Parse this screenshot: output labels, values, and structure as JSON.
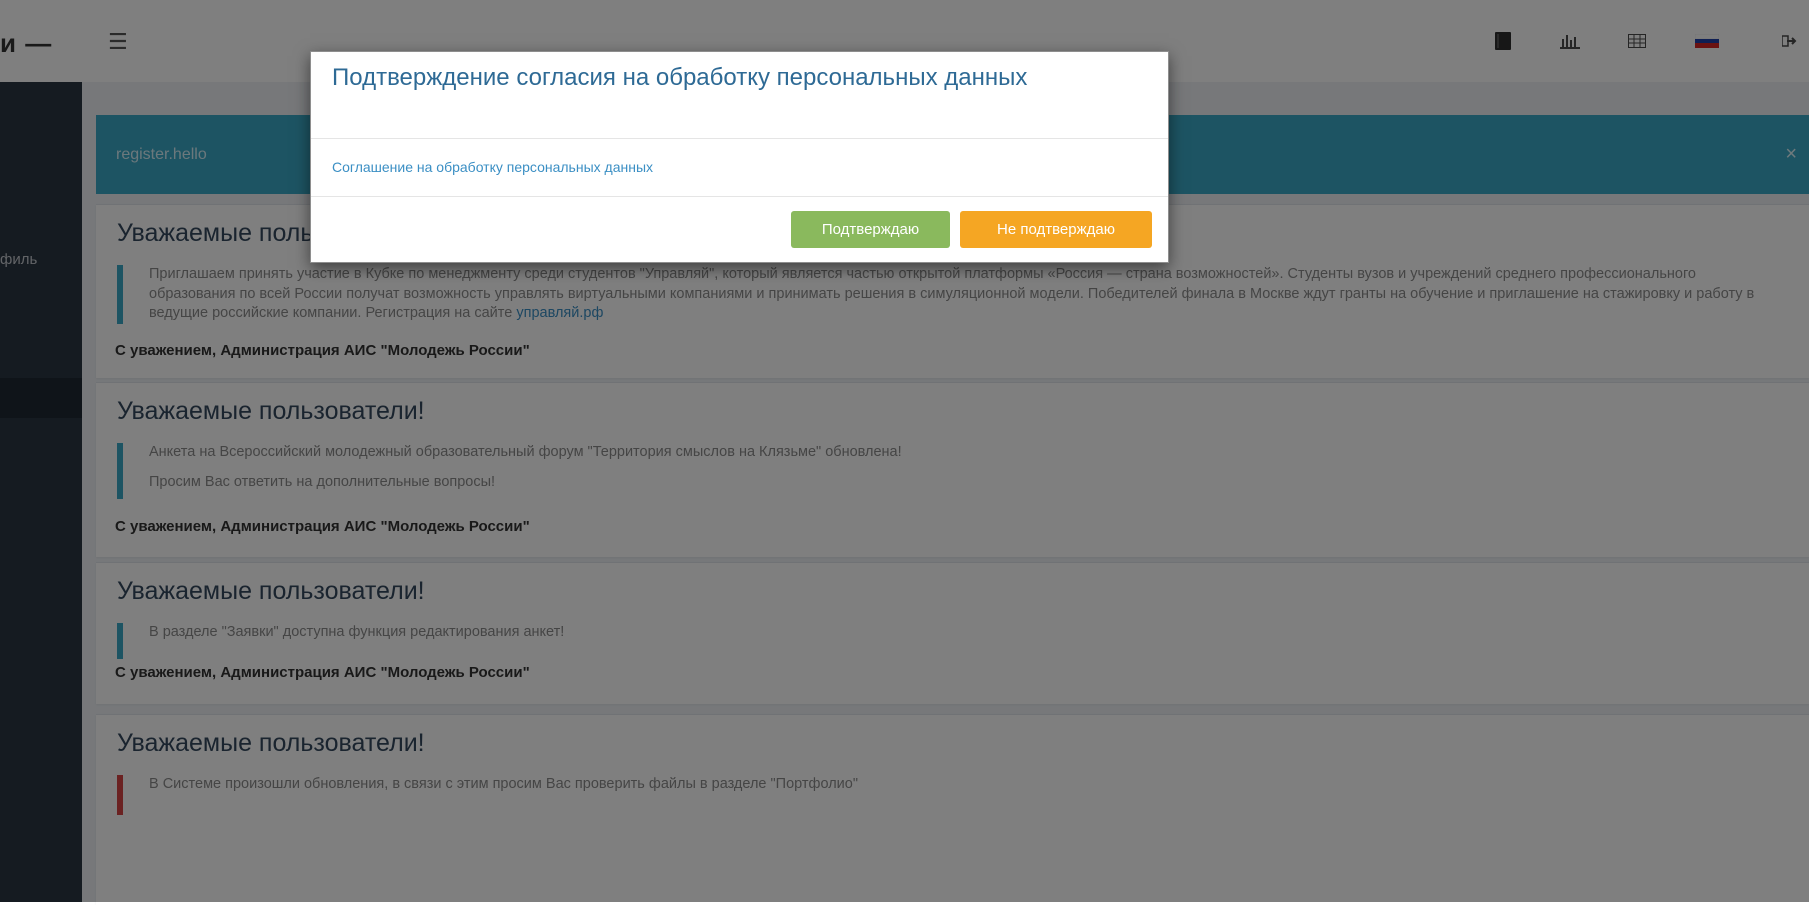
{
  "header": {
    "brand": "и —",
    "icons": {
      "book": "book-icon",
      "chart": "bar-chart-icon",
      "grid": "grid-icon",
      "flag": "russia-flag-icon",
      "logout": "logout-icon"
    }
  },
  "sidebar": {
    "items": [
      {
        "label": "филь"
      },
      {
        "label": ""
      }
    ]
  },
  "alert": {
    "text": "register.hello",
    "close": "×"
  },
  "news": [
    {
      "title": "Уважаемые пользователи!",
      "body": [
        "Приглашаем принять участие в Кубке по менеджменту среди студентов \"Управляй\", который является частью открытой платформы «Россия — страна возможностей». Студенты вузов и учреждений среднего профессионального образования по всей России получат возможность управлять виртуальными компаниями и принимать решения в симуляционной модели. Победителей финала в Москве ждут гранты на обучение и приглашение на стажировку и работу в ведущие российские компании. Регистрация на сайте"
      ],
      "link": "управляй.рф",
      "signature": "С уважением, Администрация АИС \"Молодежь России\""
    },
    {
      "title": "Уважаемые пользователи!",
      "body": [
        "Анкета на Всероссийский молодежный образовательный форум \"Территория смыслов на Клязьме\" обновлена!",
        "Просим Вас ответить на дополнительные вопросы!"
      ],
      "signature": "С уважением, Администрация АИС \"Молодежь России\""
    },
    {
      "title": "Уважаемые пользователи!",
      "body": [
        "В разделе \"Заявки\" доступна функция редактирования анкет!"
      ],
      "signature": "С уважением, Администрация АИС \"Молодежь России\""
    },
    {
      "title": "Уважаемые пользователи!",
      "body": [
        "В Системе произошли обновления, в связи с этим просим Вас проверить файлы в разделе \"Портфолио\""
      ]
    }
  ],
  "modal": {
    "title": "Подтверждение согласия на обработку персональных данных",
    "link": "Соглашение на обработку персональных данных",
    "confirm": "Подтверждаю",
    "decline": "Не подтверждаю"
  },
  "colors": {
    "accent": "#3aa8c6",
    "confirm": "#8ab95d",
    "decline": "#f5a623",
    "sidebar": "#2b3643",
    "title": "#34495e"
  }
}
